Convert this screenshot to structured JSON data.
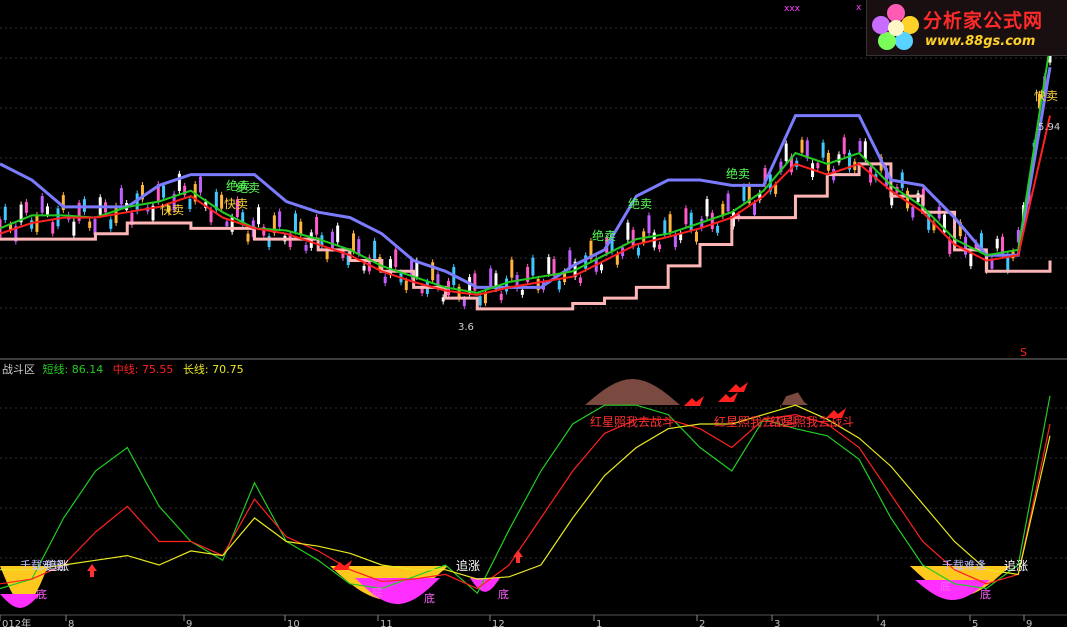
{
  "logo": {
    "title": "分析家公式网",
    "url": "www.88gs.com"
  },
  "header": {
    "panel_name": "战斗区",
    "short_label": "短线:",
    "short_value": "86.14",
    "mid_label": "中线:",
    "mid_value": "75.55",
    "long_label": "长线:",
    "long_value": "70.75"
  },
  "colors": {
    "short": "#22cc22",
    "mid": "#ff2020",
    "long": "#e8e820",
    "band_upper": "#7b7bff",
    "band_lower": "#ffb6b6",
    "fill_yellow": "#ffc81e",
    "fill_magenta": "#ff30ff",
    "fill_brown": "#7a4a40"
  },
  "top_marks": {
    "xxx": "xxx",
    "x": "x"
  },
  "price_labels": {
    "right_value": "5.94",
    "low_value": "3.6"
  },
  "signals": {
    "quick_sell": "快卖",
    "must_sell": "绝卖",
    "chase": "追涨",
    "bottom_buy": "千载难逢",
    "low_mark": "底",
    "red_star": "红星照我去战斗",
    "s_mark": "S"
  },
  "xaxis": {
    "labels": [
      "012年",
      "8",
      "9",
      "10",
      "11",
      "12",
      "1",
      "2",
      "3",
      "4",
      "5",
      "9"
    ]
  },
  "chart_data": [
    {
      "type": "line",
      "title": "",
      "series": [
        {
          "name": "band_upper",
          "values": [
            5.1,
            4.95,
            4.7,
            4.7,
            4.7,
            4.9,
            5.0,
            5.0,
            5.0,
            4.75,
            4.65,
            4.6,
            4.45,
            4.2,
            4.1,
            3.95,
            3.95,
            3.95,
            4.15,
            4.3,
            4.8,
            4.95,
            4.95,
            4.9,
            4.9,
            5.55,
            5.55,
            5.55,
            4.95,
            4.9,
            4.6,
            4.25,
            4.25,
            6.0
          ]
        },
        {
          "name": "band_lower",
          "values": [
            4.4,
            4.4,
            4.4,
            4.45,
            4.55,
            4.55,
            4.5,
            4.5,
            4.4,
            4.4,
            4.3,
            4.2,
            4.1,
            3.95,
            3.85,
            3.75,
            3.75,
            3.75,
            3.8,
            3.85,
            3.95,
            4.15,
            4.35,
            4.6,
            4.6,
            4.8,
            5.0,
            5.1,
            4.8,
            4.65,
            4.3,
            4.1,
            4.1,
            4.2
          ]
        },
        {
          "name": "ma_short",
          "values": [
            4.5,
            4.62,
            4.62,
            4.6,
            4.7,
            4.75,
            4.85,
            4.65,
            4.5,
            4.48,
            4.4,
            4.3,
            4.15,
            4.05,
            3.95,
            3.9,
            4.0,
            4.05,
            4.1,
            4.25,
            4.4,
            4.45,
            4.55,
            4.65,
            4.85,
            5.2,
            5.1,
            5.2,
            4.9,
            4.7,
            4.4,
            4.25,
            4.3,
            6.2
          ]
        },
        {
          "name": "ma_mid",
          "values": [
            4.45,
            4.55,
            4.6,
            4.6,
            4.65,
            4.7,
            4.8,
            4.6,
            4.5,
            4.45,
            4.35,
            4.25,
            4.1,
            4.0,
            3.92,
            3.88,
            3.95,
            4.0,
            4.05,
            4.2,
            4.35,
            4.42,
            4.5,
            4.6,
            4.8,
            5.1,
            5.0,
            5.1,
            4.85,
            4.65,
            4.35,
            4.2,
            4.25,
            5.55
          ]
        }
      ]
    },
    {
      "type": "line",
      "title": "战斗区",
      "ylim": [
        0,
        100
      ],
      "series": [
        {
          "name": "短线",
          "values": [
            10,
            14,
            40,
            60,
            70,
            45,
            30,
            22,
            55,
            30,
            22,
            12,
            10,
            15,
            20,
            8,
            35,
            60,
            80,
            88,
            88,
            84,
            70,
            60,
            82,
            78,
            75,
            65,
            40,
            20,
            12,
            10,
            20,
            92
          ]
        },
        {
          "name": "中线",
          "values": [
            12,
            14,
            20,
            34,
            45,
            30,
            30,
            24,
            48,
            32,
            26,
            18,
            13,
            14,
            16,
            10,
            20,
            40,
            60,
            76,
            82,
            82,
            78,
            70,
            82,
            84,
            80,
            70,
            50,
            30,
            18,
            12,
            16,
            80
          ]
        },
        {
          "name": "长线",
          "values": [
            18,
            18,
            20,
            22,
            24,
            20,
            26,
            24,
            40,
            30,
            28,
            25,
            20,
            18,
            18,
            14,
            15,
            20,
            40,
            58,
            70,
            78,
            80,
            80,
            84,
            88,
            82,
            74,
            62,
            46,
            30,
            18,
            16,
            75
          ]
        }
      ]
    }
  ]
}
